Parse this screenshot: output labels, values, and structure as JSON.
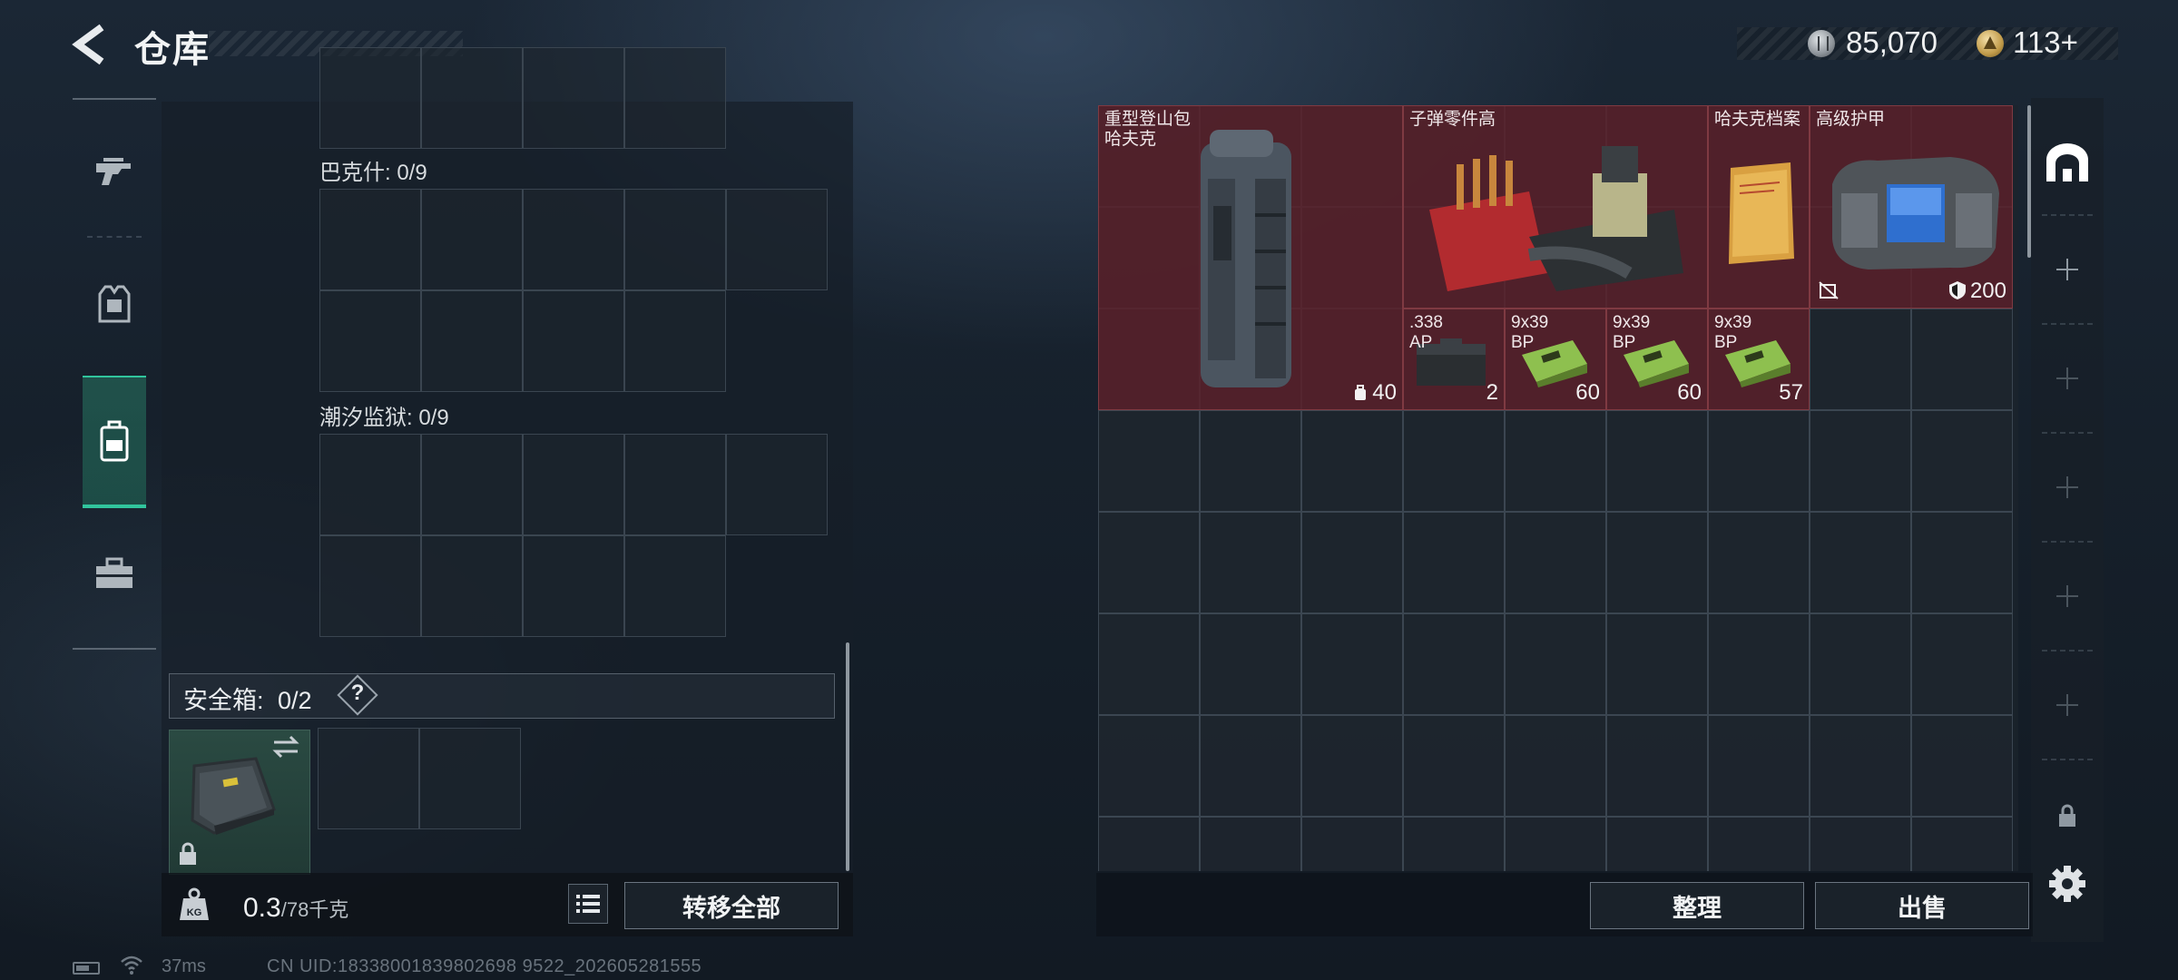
{
  "header": {
    "title": "仓库",
    "currency_silver": "85,070",
    "currency_gold": "113+"
  },
  "sections": {
    "bakesh": "巴克什: 0/9",
    "prison": "潮汐监狱: 0/9"
  },
  "safe_box": {
    "label": "安全箱:",
    "count": "0/2",
    "help": "?"
  },
  "left_bottom": {
    "weight": "0.3",
    "weight_max": "/78千克",
    "transfer_label": "转移全部"
  },
  "stash_items": [
    {
      "name": "重型登山包\n哈夫克",
      "count": "40"
    },
    {
      "name": "子弹零件高",
      "count": ""
    },
    {
      "name": "哈夫克档案",
      "count": ""
    },
    {
      "name": "高级护甲",
      "count": "200"
    },
    {
      "name": ".338\nAP",
      "count": "2"
    },
    {
      "name": "9x39\nBP",
      "count": "60"
    },
    {
      "name": "9x39\nBP",
      "count": "60"
    },
    {
      "name": "9x39\nBP",
      "count": "57"
    }
  ],
  "right_bottom": {
    "sort_label": "整理",
    "sell_label": "出售"
  },
  "status": {
    "ping": "37ms",
    "uid": "CN UID:18338001839802698 9522_202605281555"
  },
  "colors": {
    "accent_green": "#31c59d",
    "item_red": "#5c202a"
  }
}
